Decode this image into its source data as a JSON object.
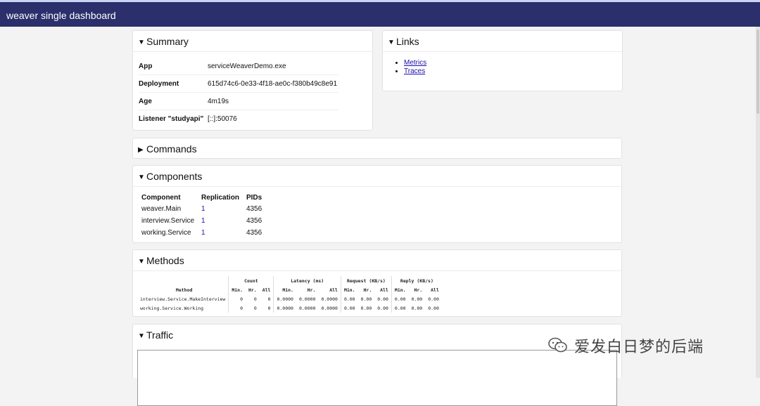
{
  "header": {
    "title": "weaver single dashboard"
  },
  "summary": {
    "title": "Summary",
    "rows": [
      {
        "key": "App",
        "value": "serviceWeaverDemo.exe"
      },
      {
        "key": "Deployment",
        "value": "615d74c6-0e33-4f18-ae0c-f380b49c8e91"
      },
      {
        "key": "Age",
        "value": "4m19s"
      },
      {
        "key": "Listener \"studyapi\"",
        "value": "[::]:50076"
      }
    ]
  },
  "links": {
    "title": "Links",
    "items": [
      {
        "label": "Metrics"
      },
      {
        "label": "Traces"
      }
    ]
  },
  "commands": {
    "title": "Commands"
  },
  "components": {
    "title": "Components",
    "headers": [
      "Component",
      "Replication",
      "PIDs"
    ],
    "rows": [
      {
        "component": "weaver.Main",
        "replication": "1",
        "pids": "4356"
      },
      {
        "component": "interview.Service",
        "replication": "1",
        "pids": "4356"
      },
      {
        "component": "working.Service",
        "replication": "1",
        "pids": "4356"
      }
    ]
  },
  "methods": {
    "title": "Methods",
    "group_headers": [
      "Count",
      "Latency (ms)",
      "Request (KB/s)",
      "Reply (KB/s)"
    ],
    "method_header": "Method",
    "sub_headers": [
      "Min.",
      "Hr.",
      "All",
      "Min.",
      "Hr.",
      "All",
      "Min.",
      "Hr.",
      "All",
      "Min.",
      "Hr.",
      "All"
    ],
    "rows": [
      {
        "name": "interview.Service.MakeInterview",
        "cells": [
          "0",
          "0",
          "0",
          "0.0000",
          "0.0000",
          "0.0000",
          "0.00",
          "0.00",
          "0.00",
          "0.00",
          "0.00",
          "0.00"
        ]
      },
      {
        "name": "working.Service.Working",
        "cells": [
          "0",
          "0",
          "0",
          "0.0000",
          "0.0000",
          "0.0000",
          "0.00",
          "0.00",
          "0.00",
          "0.00",
          "0.00",
          "0.00"
        ]
      }
    ]
  },
  "traffic": {
    "title": "Traffic"
  },
  "watermark": {
    "text": "爱发白日梦的后端"
  }
}
